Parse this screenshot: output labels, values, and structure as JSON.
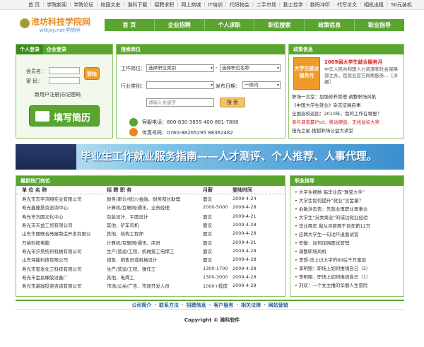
{
  "top_links": [
    "首 页",
    "学院新闻",
    "学院论坛",
    "校园文史",
    "淮科下载",
    "招聘求职",
    "网上商城",
    "IT培训",
    "代码物会",
    "二手市场",
    "勤工俭学",
    "数码冲印",
    "代写论文",
    "相机出租",
    "50元装机"
  ],
  "logo": {
    "title": "淮坊科技学院网",
    "sub": "wfkjxy.net学院网"
  },
  "nav": [
    "首 页",
    "企业招聘",
    "个人求职",
    "职位搜索",
    "政策信息",
    "职业指导"
  ],
  "login": {
    "tab_personal": "个人登录",
    "tab_company": "企业登录",
    "member_label": "会员名：",
    "password_label": "密 码：",
    "login_button": "登陆",
    "register_links": "新用户注册|忘记密码",
    "fill_resume": "填写简历"
  },
  "search": {
    "header": "搜索岗位",
    "job_label": "工作岗位：",
    "job_category": "选择职位类别",
    "job_name": "选择职位名称",
    "industry_label": "行业类别：",
    "industry_value": "",
    "publish_label": "发布日期：",
    "publish_value": "一周内",
    "keyword_placeholder": "请输入关键字",
    "search_button": "搜 索",
    "hotline": "客服电话：800-830-3859  400-881-7888",
    "fax": "传真号码：0760-88265295  88362482"
  },
  "policy": {
    "header": "政策信息",
    "feature_title": "2009届大学生就业服务月",
    "feature_text": "中华人民共和国人力资源和社会保障部主办，是就业官方网络服务...［详细］",
    "feature_image_text": "大学生就业服务月",
    "links": [
      {
        "text": "职场一言堂：加强修养管理 调整职场风帆",
        "color": "#333333"
      },
      {
        "text": "《中国大学生就业》杂志征稿启事",
        "color": "#333333"
      },
      {
        "text": "全国高校巡回：2010年，我的工作在哪里？",
        "color": "#333333"
      },
      {
        "text": "参与调查赢iPod、移动硬盘、无线鼠标大奖",
        "color": "#d42020"
      },
      {
        "text": "阳光之星-搜狐职场公益大讲堂",
        "color": "#333333"
      }
    ]
  },
  "banner_text": "毕业生工作就业服务指南——人才测评、个人推荐、人事代理。",
  "jobs": {
    "header": "最新热门岗位",
    "columns": [
      "单 位 名 称",
      "招 聘 职 务",
      "月薪",
      "登陆时间"
    ],
    "rows": [
      [
        "寿光市东宇鸿翔实业有限公司",
        "财务/审计/统计/金融、财务部长助理",
        "面议",
        "2009-4-24"
      ],
      [
        "寿光鑫隆投资咨询中心",
        "计算机/互联网/通讯、业务经理",
        "2000-5000",
        "2009-4-28"
      ],
      [
        "寿光市方圆文化中心",
        "包装设计、平面设计",
        "面议",
        "2009-4-21"
      ],
      [
        "寿光市天益工贸有限公司",
        "其他、铲车司机",
        "面议",
        "2009-4-28"
      ],
      [
        "山东华丽联合亮屋制造开发有限公",
        "其他、结构工程师",
        "面议",
        "2009-4-28"
      ],
      [
        "万维科技电脑",
        "计算机/互联网/通讯、店员",
        "面议",
        "2009-4-21"
      ],
      [
        "寿光市汐昊纺织机械有限公司",
        "生产/营运/工程、机械技工电焊工",
        "面议",
        "2009-4-28"
      ],
      [
        "山东海能科技有限公司",
        "销售、销售员或机械设计",
        "面议",
        "2009-4-28"
      ],
      [
        "寿光市宝发化工科技有限公司",
        "生产/营运/工程、操作工",
        "1300-1700",
        "2009-4-28"
      ],
      [
        "寿光市金昌橡胶设备厂",
        "其他、电焊工",
        "1300-3000",
        "2009-4-28"
      ],
      [
        "寿光市基础投资咨询有限公司",
        "市场/公关/广告、市场开发人员",
        "1000+提成",
        "2009-4-28"
      ]
    ]
  },
  "guide": {
    "header": "职业指导",
    "items": [
      "大学生摆摊 临毕业成“珠宝大亨”",
      "大学生如何提升“就业”含金量？",
      "俞敏洪忠告：先就业再职业再事业",
      "大学生“另类择业”的成功就业经验",
      "毕业两年 我从月薪两千到年薪12万",
      "应聘大学生一句话吓退面试官",
      "安徽：加何加强面试管理",
      "调整职场风帆",
      "李想-没上过大学的80后千万富翁",
      "李明翔：职场上如何推销自己（2）",
      "李明翔：职场上如何推销自己（1）",
      "刘欢：一个女主播的华丽人生冒险"
    ]
  },
  "footer": {
    "links": [
      "公司简介",
      "联系方法",
      "招聘信息",
      "客户服务",
      "相关法律",
      "网站营销"
    ],
    "copyright": "Copyright © 潍科软件"
  }
}
